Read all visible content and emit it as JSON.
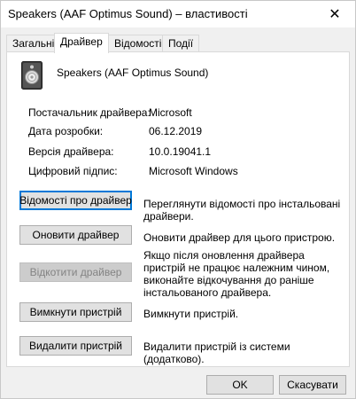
{
  "window": {
    "title": "Speakers (AAF Optimus Sound) – властивості",
    "close_glyph": "✕"
  },
  "tabs": [
    {
      "label": "Загальні",
      "active": false
    },
    {
      "label": "Драйвер",
      "active": true
    },
    {
      "label": "Відомості",
      "active": false
    },
    {
      "label": "Події",
      "active": false
    }
  ],
  "device": {
    "name": "Speakers (AAF Optimus Sound)",
    "icon": "speaker-icon"
  },
  "properties": [
    {
      "label": "Постачальник драйвера:",
      "value": "Microsoft"
    },
    {
      "label": "Дата розробки:",
      "value": "06.12.2019"
    },
    {
      "label": "Версія драйвера:",
      "value": "10.0.19041.1"
    },
    {
      "label": "Цифровий підпис:",
      "value": "Microsoft Windows"
    }
  ],
  "actions": [
    {
      "label": "Відомості про драйвер",
      "description": "Переглянути відомості про інстальовані драйвери.",
      "enabled": true
    },
    {
      "label": "Оновити драйвер",
      "description": "Оновити драйвер для цього пристрою.",
      "enabled": true
    },
    {
      "label": "Відкотити драйвер",
      "description": "Якщо після оновлення драйвера пристрій не працює належним чином, виконайте відкочування до раніше інстальованого драйвера.",
      "enabled": false
    },
    {
      "label": "Вимкнути пристрій",
      "description": "Вимкнути пристрій.",
      "enabled": true
    },
    {
      "label": "Видалити пристрій",
      "description": "Видалити пристрій із системи (додатково).",
      "enabled": true
    }
  ],
  "footer": {
    "ok_label": "OK",
    "cancel_label": "Скасувати"
  },
  "colors": {
    "focus_border": "#0078d7",
    "button_bg": "#e1e1e1",
    "disabled_text": "#838383"
  }
}
